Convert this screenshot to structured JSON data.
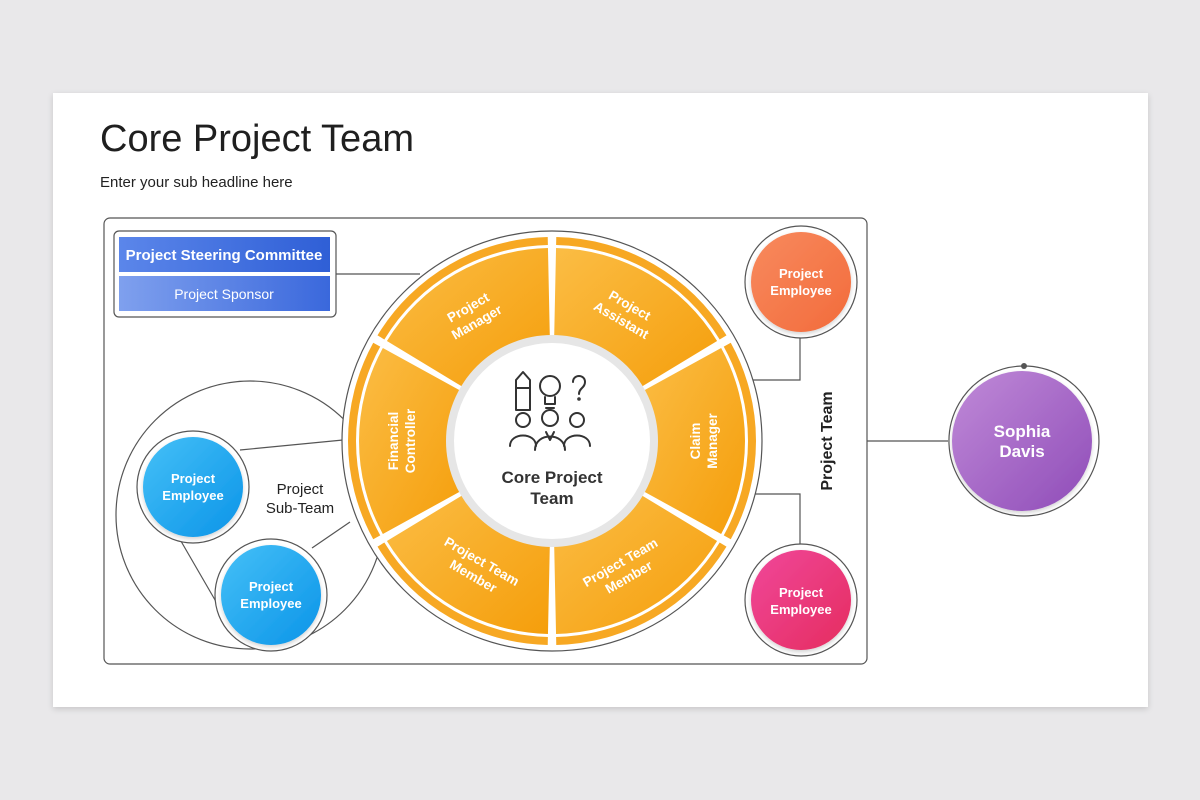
{
  "slide": {
    "title": "Core Project Team",
    "subtitle": "Enter your sub headline here"
  },
  "committee": {
    "header": "Project Steering Committee",
    "sponsor": "Project Sponsor"
  },
  "wheel": {
    "center_line1": "Core Project",
    "center_line2": "Team",
    "center_icon": "team-idea-icon",
    "segments": [
      {
        "line1": "Project",
        "line2": "Manager"
      },
      {
        "line1": "Project",
        "line2": "Assistant"
      },
      {
        "line1": "Claim",
        "line2": "Manager"
      },
      {
        "line1": "Project Team",
        "line2": "Member"
      },
      {
        "line1": "Project Team",
        "line2": "Member"
      },
      {
        "line1": "Financial",
        "line2": "Controller"
      }
    ]
  },
  "sub_team": {
    "label_line1": "Project",
    "label_line2": "Sub-Team",
    "employee1_line1": "Project",
    "employee1_line2": "Employee",
    "employee2_line1": "Project",
    "employee2_line2": "Employee"
  },
  "right": {
    "top_employee_line1": "Project",
    "top_employee_line2": "Employee",
    "bottom_employee_line1": "Project",
    "bottom_employee_line2": "Employee",
    "vertical_label": "Project Team"
  },
  "person": {
    "first": "Sophia",
    "last": "Davis"
  },
  "colors": {
    "orange": "#f7a823",
    "blue_circle": "#1ea7f0",
    "coral": "#f47a4d",
    "pink": "#e8306f",
    "purple": "#a05fc2",
    "committee_blue": "#3f6fe0"
  }
}
